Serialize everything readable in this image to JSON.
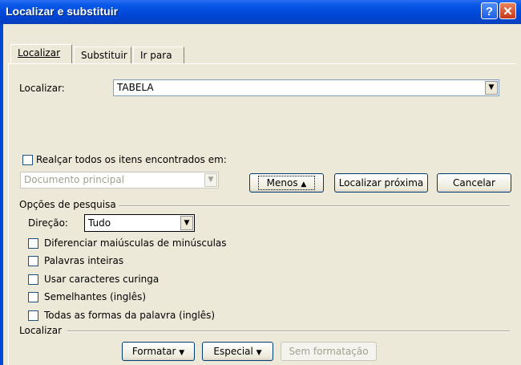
{
  "window": {
    "title": "Localizar e substituir"
  },
  "tabs": {
    "find": "Localizar",
    "replace": "Substituir",
    "goto": "Ir para"
  },
  "find": {
    "label": "Localizar:",
    "value": "TABELA"
  },
  "highlight": {
    "label": "Realçar todos os itens encontrados em:",
    "scope_value": "Documento principal"
  },
  "buttons": {
    "less": "Menos",
    "find_next": "Localizar próxima",
    "cancel": "Cancelar",
    "format": "Formatar",
    "special": "Especial",
    "no_format": "Sem formatação"
  },
  "search_options": {
    "heading": "Opções de pesquisa",
    "direction_label": "Direção:",
    "direction_value": "Tudo"
  },
  "options": [
    "Diferenciar maiúsculas de minúsculas",
    "Palavras inteiras",
    "Usar caracteres curinga",
    "Semelhantes (inglês)",
    "Todas as formas da palavra (inglês)"
  ],
  "bottom": {
    "heading": "Localizar"
  },
  "icons": {
    "help": "help-icon",
    "close": "close-icon",
    "dropdown": "chevron-down-icon",
    "less": "chevron-up-icon"
  }
}
